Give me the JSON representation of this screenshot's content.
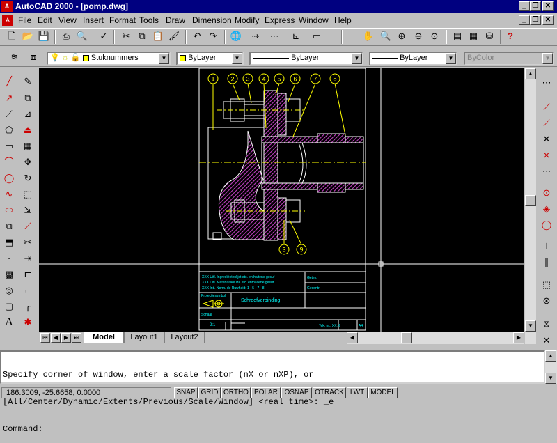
{
  "window": {
    "title": "AutoCAD 2000 - [pomp.dwg]",
    "app_icon": "autocad-icon"
  },
  "menu": {
    "items": [
      "File",
      "Edit",
      "View",
      "Insert",
      "Format",
      "Tools",
      "Draw",
      "Dimension",
      "Modify",
      "Express",
      "Window",
      "Help"
    ]
  },
  "standard_toolbar": {
    "icons": [
      "new-icon",
      "open-icon",
      "save-icon",
      "print-icon",
      "preview-icon",
      "spell-icon",
      "cut-icon",
      "copy-icon",
      "paste-icon",
      "matchprop-icon",
      "undo-icon",
      "redo-icon",
      "browse-web-icon",
      "snap-from-icon",
      "tracking-icon",
      "ucs-icon",
      "redraw-icon",
      "pan-icon",
      "zoom-realtime-icon",
      "zoom-window-icon",
      "zoom-previous-icon",
      "properties-icon",
      "designcenter-icon",
      "dbconnect-icon",
      "help-icon"
    ]
  },
  "layers_toolbar": {
    "layer_name": "Stuknummers",
    "color": "ByLayer",
    "linetype": "ByLayer",
    "lineweight": "ByLayer",
    "plotstyle": "ByColor"
  },
  "drawing": {
    "balloons": [
      "1",
      "2",
      "3",
      "4",
      "5",
      "6",
      "7",
      "8"
    ],
    "bottom_balloons": [
      "3",
      "9"
    ],
    "title_block": {
      "revisions": [
        "XXX Uitl. Ingrediëntenlijst etc. enthaltene gesuf",
        "XXX Uitl. Materiaalkeuze etc. enthaltene gesuf",
        "XXX Intl. Norm. de Ruwheid: 1 - 5 - 7 - 8"
      ],
      "field_1": "Getek.",
      "field_2": "Gecontr.",
      "projection_label": "Projectiesymbol",
      "drawing_title": "Schroefverbinding",
      "scale_label": "Schaal",
      "sheet": "2:1",
      "drawing_number": "Tek. nr.: XX:X",
      "format": "A4"
    }
  },
  "layout_tabs": {
    "tabs": [
      "Model",
      "Layout1",
      "Layout2"
    ],
    "active": "Model"
  },
  "command": {
    "line1": "Specify corner of window, enter a scale factor (nX or nXP), or",
    "line2": "[All/Center/Dynamic/Extents/Previous/Scale/Window] <real time>: _e",
    "prompt": "Command:"
  },
  "status": {
    "coordinates": "186.3009, -25.6658, 0.0000",
    "toggles": [
      "SNAP",
      "GRID",
      "ORTHO",
      "POLAR",
      "OSNAP",
      "OTRACK",
      "LWT",
      "MODEL"
    ]
  },
  "colors": {
    "drawing_white": "#ffffff",
    "balloon_yellow": "#ffff00",
    "hatch_magenta": "#c040c0",
    "text_cyan": "#00ffff",
    "canvas": "#000000",
    "title_bar": "#000080"
  }
}
